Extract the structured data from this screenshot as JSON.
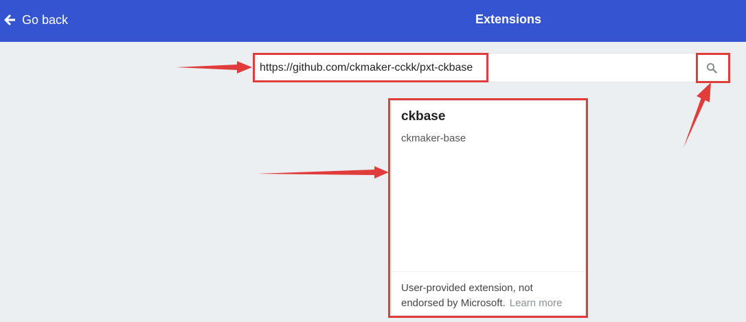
{
  "header": {
    "back_label": "Go back",
    "title": "Extensions",
    "back_icon": "arrow-left-icon"
  },
  "search": {
    "value": "https://github.com/ckmaker-cckk/pxt-ckbase",
    "button_icon": "search-icon"
  },
  "result_card": {
    "name": "ckbase",
    "description": "ckmaker-base",
    "disclaimer": "User-provided extension, not endorsed by Microsoft.",
    "learn_more": "Learn more"
  },
  "colors": {
    "header_bg": "#3454d1",
    "page_bg": "#eceff1",
    "annotation": "#e03c3c"
  }
}
